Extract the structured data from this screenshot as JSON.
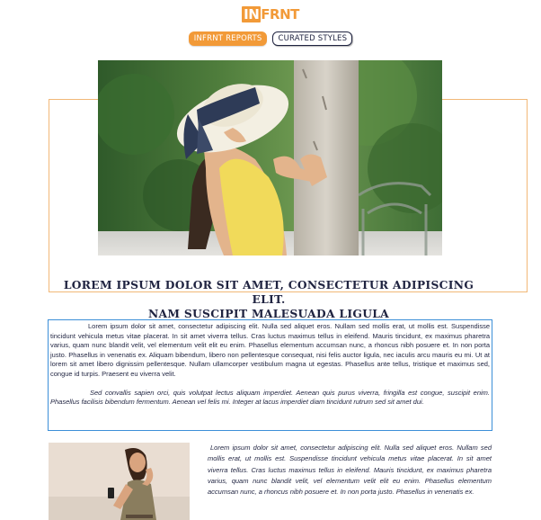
{
  "logo": {
    "prefix": "IN",
    "rest": "FRNT"
  },
  "tabs": [
    {
      "label": "INFRNT REPORTS",
      "active": true
    },
    {
      "label": "CURATED STYLES",
      "active": false
    }
  ],
  "colors": {
    "accent": "#f29a38",
    "navy": "#1f2340",
    "frame_orange": "#f2b877",
    "frame_blue": "#3c8fd8"
  },
  "hero": {
    "alt": "woman in sun hat"
  },
  "headline": {
    "line1": "LOREM IPSUM DOLOR SIT AMET, CONSECTETUR ADIPISCING ELIT.",
    "line2": "NAM SUSCIPIT MALESUADA LIGULA"
  },
  "article": {
    "para1": "Lorem ipsum dolor sit amet, consectetur adipiscing elit. Nulla sed aliquet eros. Nullam sed mollis erat, ut mollis est. Suspendisse tincidunt vehicula metus vitae placerat. In sit amet viverra tellus. Cras luctus maximus tellus in eleifend. Mauris tincidunt, ex maximus pharetra varius, quam nunc blandit velit, vel elementum velit elit eu enim. Phasellus elementum accumsan nunc, a rhoncus nibh posuere et. In non porta justo. Phasellus in venenatis ex. Aliquam bibendum, libero non pellentesque consequat, nisi felis auctor ligula, nec iaculis arcu mauris eu mi. Ut at lorem sit amet libero dignissim pellentesque. Nullam ullamcorper vestibulum magna ut egestas. Phasellus ante tellus, tristique et maximus sed, congue id turpis. Praesent eu viverra velit.",
    "para2": "Sed convallis sapien orci, quis volutpat lectus aliquam imperdiet. Aenean quis purus viverra, fringilla est congue, suscipit enim. Phasellus facilisis bibendum fermentum. Aenean vel felis mi. Integer at lacus imperdiet diam tincidunt rutrum sed sit amet dui."
  },
  "side": {
    "text": "Lorem ipsum dolor sit amet, consectetur adipiscing elit. Nulla sed aliquet eros. Nullam sed mollis erat, ut mollis est. Suspendisse tincidunt vehicula metus vitae placerat. In sit amet viverra tellus.  Cras luctus maximus tellus in eleifend. Mauris tincidunt, ex maximus pharetra varius, quam nunc blandit velit, vel elementum velit elit eu enim. Phasellus elementum accumsan nunc, a rhoncus nibh posuere et. In non porta justo. Phasellus in venenatis ex."
  }
}
